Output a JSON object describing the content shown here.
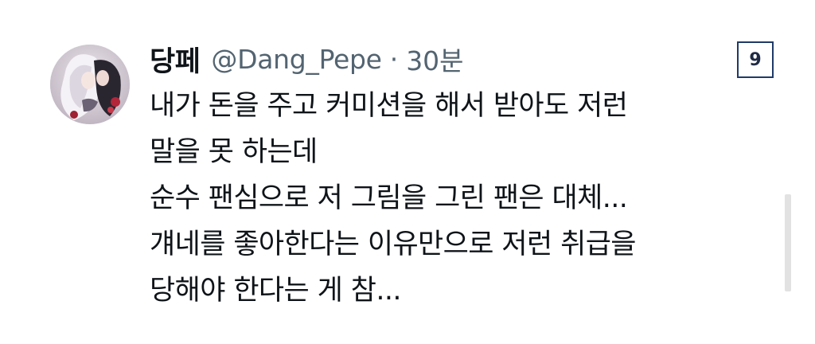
{
  "tweet": {
    "display_name": "당페",
    "handle": "@Dang_Pepe",
    "separator": "·",
    "time": "30분",
    "lines": [
      "내가 돈을 주고 커미션을 해서 받아도 저런",
      "말을 못 하는데",
      "순수 팬심으로 저 그림을 그린 팬은 대체...",
      "걔네를 좋아한다는 이유만으로 저런 취급을",
      "당해야 한다는 게 참..."
    ]
  },
  "badge": {
    "number": "9"
  },
  "colors": {
    "text": "#0f1419",
    "secondary": "#536471",
    "badge_border": "#1f3a68"
  },
  "icons": {
    "avatar": "avatar-illustration"
  }
}
